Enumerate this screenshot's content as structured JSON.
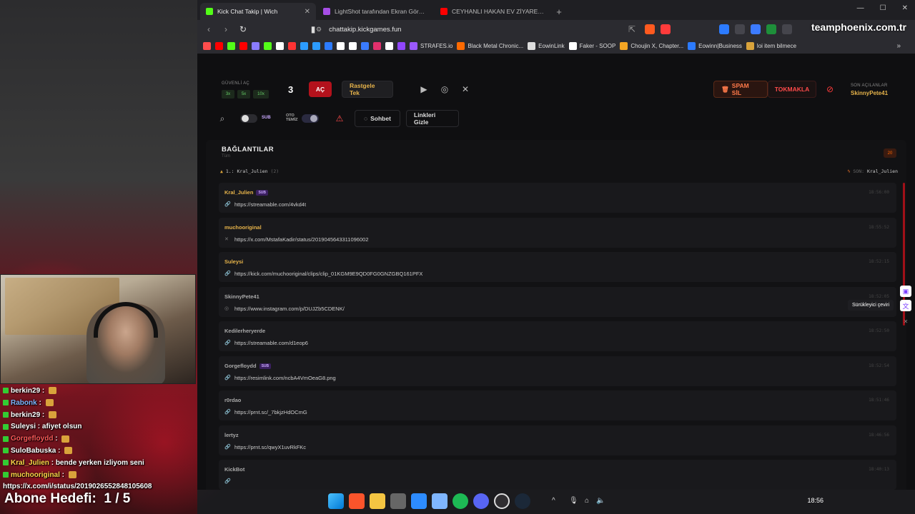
{
  "stream": {
    "chat": [
      {
        "user": "berkin29",
        "text": "",
        "color": "#ffffff"
      },
      {
        "user": "Rabonk",
        "text": "",
        "color": "#7fb6ff"
      },
      {
        "user": "berkin29",
        "text": "",
        "color": "#ffffff"
      },
      {
        "user": "Suleysi",
        "text": "afiyet olsun",
        "color": "#ffffff"
      },
      {
        "user": "Gorgefloydd",
        "text": "",
        "color": "#ff5a5a"
      },
      {
        "user": "SuloBabuska",
        "text": "",
        "color": "#ffffff"
      },
      {
        "user": "Kral_Julien",
        "text": "bende yerken izliyom seni",
        "color": "#ffd84a"
      },
      {
        "user": "muchooriginal",
        "text": "",
        "color": "#ffd84a"
      },
      {
        "user": "",
        "text": "https://x.com/i/status/2019026552848105608",
        "color": "#ffffff"
      }
    ],
    "sub_goal_label": "Abone Hedefi:",
    "sub_goal_value": "1 / 5"
  },
  "browser": {
    "tabs": [
      {
        "title": "Kick Chat Takip | Wich",
        "active": true,
        "color": "#53fc18"
      },
      {
        "title": "LightShot tarafından Ekran Görüntüsü",
        "active": false,
        "color": "#a64ee6"
      },
      {
        "title": "CEYHANLI HAKAN EV ZİYARETİ - You",
        "active": false,
        "color": "#ff0000"
      }
    ],
    "url": "chattakip.kickgames.fun",
    "overlay_brand": "teamphoenix.com.tr",
    "bookmarks": [
      {
        "label": "STRAFES.io",
        "color": "#9b59ff"
      },
      {
        "label": "Black Metal Chronic...",
        "color": "#ff6a00"
      },
      {
        "label": "EowinLink",
        "color": "#dddddd"
      },
      {
        "label": "Faker - SOOP",
        "color": "#ffffff"
      },
      {
        "label": "Choujin X, Chapter...",
        "color": "#f5a623"
      },
      {
        "label": "Eowinn|Business",
        "color": "#2c7bff"
      },
      {
        "label": "loi item bilmece",
        "color": "#d9a33b"
      }
    ],
    "bookmark_icon_colors": [
      "#ff4d4d",
      "#ff0000",
      "#53fc18",
      "#ff0000",
      "#8a7cff",
      "#53fc18",
      "#ffffff",
      "#ff3333",
      "#2c9cff",
      "#2c9cff",
      "#2c7bff",
      "#ffffff",
      "#ffffff",
      "#3a7bff",
      "#e1306c",
      "#ffffff",
      "#9146ff"
    ]
  },
  "toolbar": {
    "safe_open_label": "GÜVENLİ AÇ",
    "multipliers": [
      "3x",
      "5x",
      "10x"
    ],
    "count": "3",
    "open_button": "AÇ",
    "random_button": "Rastgele Tek",
    "spam_delete": "SPAM SİL",
    "kick_button": "TOKMAKLA",
    "last_opened_label": "SON AÇILANLAR",
    "last_opened_user": "SkinnyPete41",
    "sub_toggle_label": "SUB",
    "auto_clean_label_1": "OTO",
    "auto_clean_label_2": "TEMİZ",
    "chat_button": "Sohbet",
    "hide_links_button": "Linkleri Gizle"
  },
  "links": {
    "title": "BAĞLANTILAR",
    "subtitle": "Tüm",
    "count": "20",
    "first_prefix": "1.:",
    "first_user": "Kral_Julien",
    "first_extra": "(2)",
    "last_prefix": "SON:",
    "last_user": "Kral_Julien",
    "items": [
      {
        "user": "Kral_Julien",
        "sub": true,
        "url": "https://streamable.com/4vkd4t",
        "time": "18:56:00",
        "icon": "link",
        "color": "#e6b34a"
      },
      {
        "user": "muchooriginal",
        "sub": false,
        "url": "https://x.com/MstafaKadir/status/2019045643311096002",
        "time": "18:55:52",
        "icon": "x",
        "color": "#e6b34a"
      },
      {
        "user": "Suleysi",
        "sub": false,
        "url": "https://kick.com/muchooriginal/clips/clip_01KGM9E9QD0FG0GNZGBQ161PFX",
        "time": "18:52:15",
        "icon": "link",
        "color": "#e6b34a"
      },
      {
        "user": "SkinnyPete41",
        "sub": false,
        "url": "https://www.instagram.com/p/DUJZb5CDENK/",
        "time": "18:52:05",
        "icon": "instagram",
        "color": "#aaaaaa"
      },
      {
        "user": "Kedilerheryerde",
        "sub": false,
        "url": "https://streamable.com/d1eop6",
        "time": "18:52:50",
        "icon": "link",
        "color": "#aaaaaa"
      },
      {
        "user": "Gorgefloydd",
        "sub": true,
        "url": "https://resimlink.com/ncbA4VmOeaG8.png",
        "time": "18:52:54",
        "icon": "link",
        "color": "#aaaaaa"
      },
      {
        "user": "r0rdao",
        "sub": false,
        "url": "https://prnt.sc/_7bkjzHdOCmG",
        "time": "18:51:46",
        "icon": "link",
        "color": "#aaaaaa"
      },
      {
        "user": "lertyz",
        "sub": false,
        "url": "https://prnt.sc/qwyX1uvRkFKc",
        "time": "18:46:56",
        "icon": "link",
        "color": "#aaaaaa"
      },
      {
        "user": "KickBot",
        "sub": false,
        "url": "",
        "time": "18:40:13",
        "icon": "link",
        "color": "#aaaaaa"
      }
    ]
  },
  "side_tooltip": "Sürükleyici çeviri",
  "taskbar": {
    "clock": "18:56"
  }
}
